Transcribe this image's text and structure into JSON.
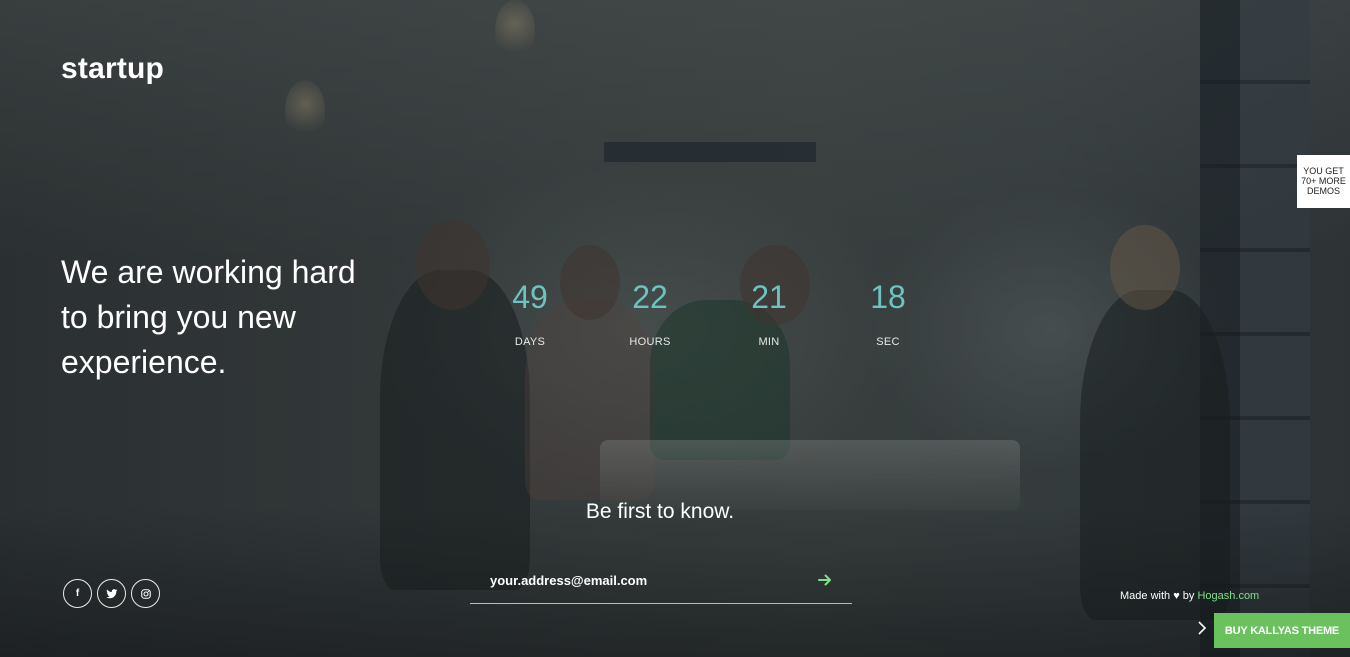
{
  "brand": {
    "logo_text": "startup"
  },
  "hero": {
    "headline_line1": "We are working hard",
    "headline_line2": "to bring you new",
    "headline_line3": "experience."
  },
  "countdown": [
    {
      "value": "49",
      "label": "DAYS"
    },
    {
      "value": "22",
      "label": "HOURS"
    },
    {
      "value": "21",
      "label": "MIN"
    },
    {
      "value": "18",
      "label": "SEC"
    }
  ],
  "subscribe": {
    "tagline": "Be first to know.",
    "email_placeholder": "your.address@email.com",
    "submit_icon": "arrow-right-icon"
  },
  "social": [
    {
      "name": "facebook-icon",
      "glyph": "f"
    },
    {
      "name": "twitter-icon",
      "glyph": "t"
    },
    {
      "name": "instagram-icon",
      "glyph": "◎"
    }
  ],
  "footer": {
    "made_with": "Made with ♥ by",
    "made_by": "Hogash.com"
  },
  "promo": {
    "demos_line1": "YOU GET",
    "demos_line2": "70+ MORE",
    "demos_line3": "DEMOS",
    "buy_label": "BUY KALLYAS THEME"
  },
  "colors": {
    "accent_green": "#7fe089",
    "countdown_teal": "#6cc3c0",
    "buy_button": "#6ac15e"
  }
}
